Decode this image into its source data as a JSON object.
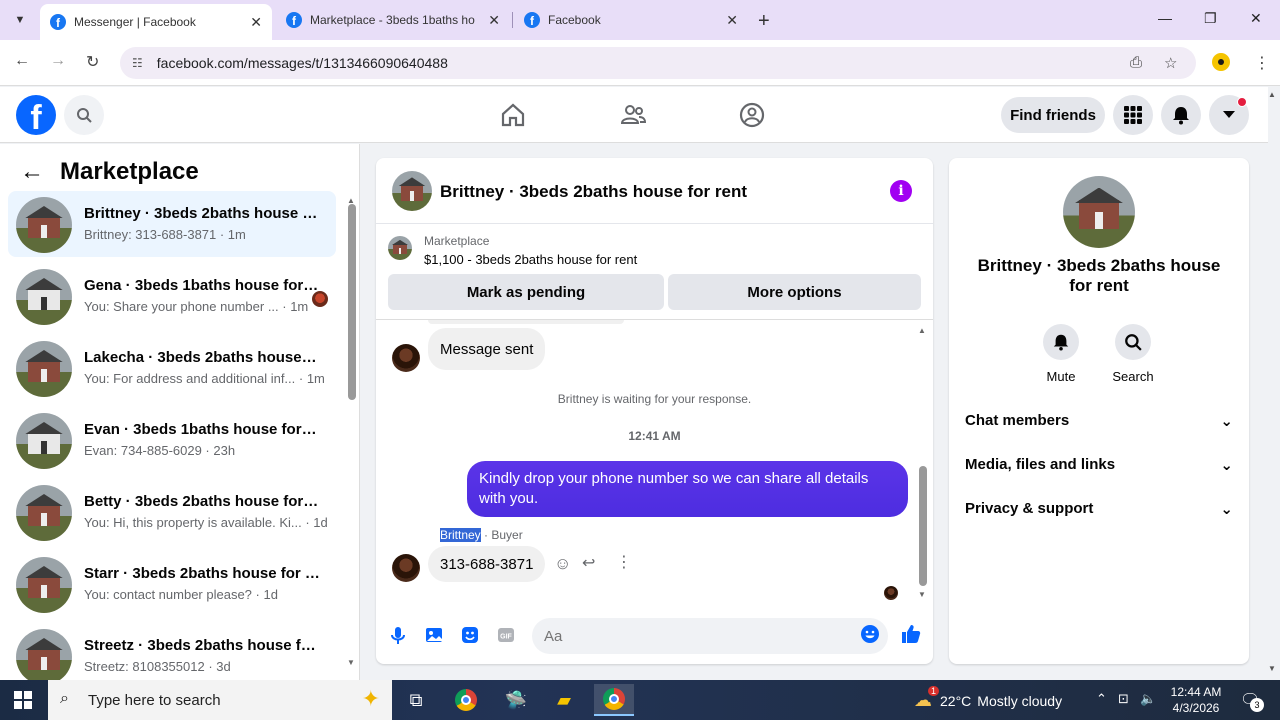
{
  "browser": {
    "tabs": [
      {
        "title": "Messenger | Facebook",
        "active": true
      },
      {
        "title": "Marketplace - 3beds 1baths ho",
        "active": false
      },
      {
        "title": "Facebook",
        "active": false
      }
    ],
    "url": "facebook.com/messages/t/1313466090640488"
  },
  "fbnav": {
    "find_friends": "Find friends"
  },
  "sidebar": {
    "title": "Marketplace",
    "conversations": [
      {
        "name": "Brittney · 3beds 2baths house for rent",
        "preview": "Brittney: 313-688-3871 · 1m",
        "active": true,
        "avatar": "house-brick"
      },
      {
        "name": "Gena · 3beds 1baths house for rent",
        "preview": "You: Share your phone number ... · 1m",
        "active": false,
        "avatar": "house-white"
      },
      {
        "name": "Lakecha · 3beds 2baths house for rent",
        "preview": "You: For address and additional inf... · 1m",
        "active": false,
        "avatar": "house-brick"
      },
      {
        "name": "Evan · 3beds 1baths house for rent",
        "preview": "Evan: 734-885-6029 · 23h",
        "active": false,
        "avatar": "house-white"
      },
      {
        "name": "Betty · 3beds 2baths house for rent",
        "preview": "You: Hi, this property is available. Ki... · 1d",
        "active": false,
        "avatar": "house-brick"
      },
      {
        "name": "Starr · 3beds 2baths house for rent",
        "preview": "You: contact number please? · 1d",
        "active": false,
        "avatar": "house-brick"
      },
      {
        "name": "Streetz · 3beds 2baths house for rent",
        "preview": "Streetz: 8108355012 · 3d",
        "active": false,
        "avatar": "house-brick"
      }
    ]
  },
  "chat": {
    "title": "Brittney · 3beds 2baths house for rent",
    "marketplace_label": "Marketplace",
    "listing": "$1,100 - 3beds 2baths house for rent",
    "mark_pending": "Mark as pending",
    "more_options": "More options",
    "msg_sent": "Message sent",
    "waiting": "Brittney is waiting for your response.",
    "time": "12:41 AM",
    "outgoing": "Kindly drop your phone number so we can share all details with you.",
    "sender_name": "Brittney",
    "sender_role": " · Buyer",
    "incoming": "313-688-3871",
    "composer_placeholder": "Aa"
  },
  "right": {
    "title": "Brittney · 3beds 2baths house for rent",
    "mute": "Mute",
    "search": "Search",
    "sections": [
      "Chat members",
      "Media, files and links",
      "Privacy & support"
    ]
  },
  "taskbar": {
    "search_placeholder": "Type here to search",
    "weather_temp": "22°C",
    "weather_desc": "Mostly cloudy",
    "weather_badge": "1",
    "time": "12:44 AM",
    "date": "4/3/2026",
    "notif_count": "3"
  }
}
